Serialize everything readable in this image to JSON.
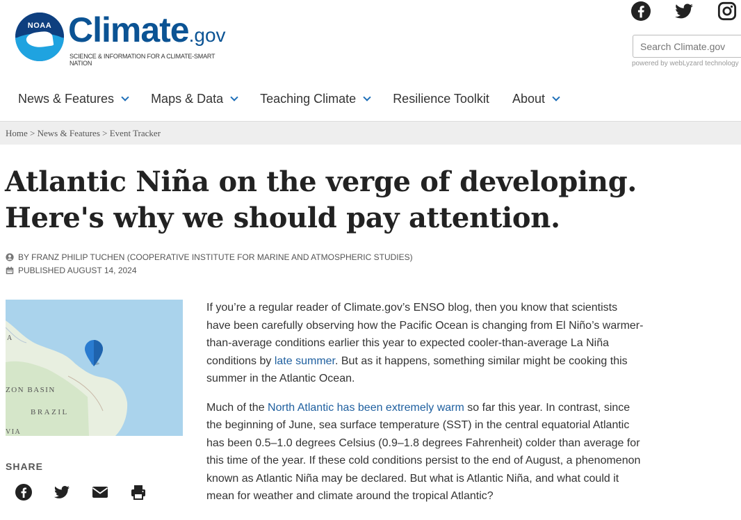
{
  "brand": {
    "noaa": "NOAA",
    "word": "Climate",
    "gov": ".gov",
    "tagline": "SCIENCE & INFORMATION FOR A CLIMATE-SMART NATION"
  },
  "social": [
    "facebook-icon",
    "twitter-icon",
    "instagram-icon"
  ],
  "search": {
    "placeholder": "Search Climate.gov",
    "powered": "powered by webLyzard technology"
  },
  "nav": {
    "items": [
      {
        "label": "News & Features",
        "dropdown": true
      },
      {
        "label": "Maps & Data",
        "dropdown": true
      },
      {
        "label": "Teaching Climate",
        "dropdown": true
      },
      {
        "label": "Resilience Toolkit",
        "dropdown": false
      },
      {
        "label": "About",
        "dropdown": true
      }
    ]
  },
  "breadcrumb": {
    "home": "Home",
    "news": "News & Features",
    "current": "Event Tracker",
    "sep": ">"
  },
  "article": {
    "title": "Atlantic Niña on the verge of developing. Here's why we should pay attention.",
    "author": "BY FRANZ PHILIP TUCHEN (COOPERATIVE INSTITUTE FOR MARINE AND ATMOSPHERIC STUDIES)",
    "published": "PUBLISHED AUGUST 14, 2024",
    "p1_a": "If you’re a regular reader of Climate.gov’s ENSO blog, then you know that scientists have been carefully observing how the Pacific Ocean is changing from El Niño’s warmer-than-average conditions earlier this year to expected cooler-than-average La Niña conditions by ",
    "p1_link": "late summer",
    "p1_b": ". But as it happens, something similar might be cooking this summer in the Atlantic Ocean.",
    "p2_a": "Much of the ",
    "p2_link": "North Atlantic has been extremely warm",
    "p2_b": " so far this year. In contrast, since the beginning of June, sea surface temperature (SST) in the central equatorial Atlantic has been 0.5–1.0 degrees Celsius (0.9–1.8 degrees Fahrenheit) colder than average for this time of the year. If these cold conditions persist to the end of August, a phenomenon known as Atlantic Niña may be declared. But what is Atlantic Niña, and what could it mean for weather and climate around the tropical Atlantic?"
  },
  "map": {
    "label_basin": "ZON BASIN",
    "label_brazil": "BRAZIL",
    "label_a": "A",
    "label_via": "VIA"
  },
  "share": {
    "label": "SHARE",
    "icons": [
      "facebook-icon",
      "twitter-icon",
      "email-icon",
      "print-icon"
    ]
  },
  "colors": {
    "brand": "#0b5394",
    "link": "#1e5f9f",
    "chevron": "#1e6fb8",
    "marker": "#2a7bd0"
  }
}
